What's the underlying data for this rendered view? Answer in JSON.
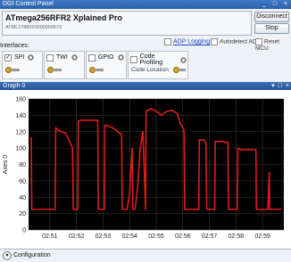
{
  "window": {
    "title": "DGI Control Panel",
    "buttons": [
      "_",
      "□",
      "×"
    ]
  },
  "device": {
    "name": "ATmega256RFR2 Xplained Pro",
    "serial": "ATML1788020000000573"
  },
  "buttons": {
    "disconnect": "Disconnect",
    "stop": "Stop"
  },
  "options": {
    "adp_logging": "ADP Logging",
    "autodetect_adp": "Autodetect ADP",
    "reset_mcu": "Reset MCU"
  },
  "interfaces": {
    "label": "Interfaces:",
    "items": [
      {
        "name": "SPI",
        "checked": true
      },
      {
        "name": "TWI",
        "checked": false
      },
      {
        "name": "GPIO",
        "checked": false
      }
    ],
    "code_profiling": {
      "name": "Code Profiling",
      "checked": false,
      "location_label": "Code Location"
    }
  },
  "graph": {
    "title": "Graph 0",
    "buttons": [
      "▾",
      "□",
      "×"
    ]
  },
  "configuration": {
    "label": "Configuration"
  },
  "chart_data": {
    "type": "line",
    "ylabel": "Axes 0",
    "xlabel": "",
    "ylim": [
      0,
      160
    ],
    "yticks": [
      0,
      20,
      40,
      60,
      80,
      100,
      120,
      140,
      160
    ],
    "xticks": [
      "02:51",
      "02:52",
      "02:53",
      "02:54",
      "02:55",
      "02:56",
      "02:57",
      "02:58",
      "02:59"
    ],
    "xlim": [
      50.2,
      59.8
    ],
    "grid": true,
    "colors": {
      "background": "#000000",
      "line": "#e01b1b",
      "grid": "#3a3a3a",
      "tick_text": "#222222"
    },
    "series": [
      {
        "name": "",
        "x": [
          50.25,
          50.3,
          50.32,
          50.5,
          50.7,
          51.1,
          51.2,
          51.22,
          51.3,
          51.6,
          51.85,
          51.88,
          52.0,
          52.05,
          52.07,
          52.2,
          52.6,
          52.8,
          52.82,
          53.0,
          53.05,
          53.07,
          53.2,
          53.4,
          53.7,
          53.72,
          53.9,
          54.0,
          54.05,
          54.1,
          54.12,
          54.2,
          54.3,
          54.4,
          54.5,
          54.6,
          54.62,
          54.8,
          55.0,
          55.2,
          55.4,
          55.6,
          55.8,
          55.9,
          56.0,
          56.05,
          56.07,
          56.1,
          56.3,
          56.5,
          56.6,
          56.62,
          56.8,
          56.85,
          56.87,
          56.9,
          57.0,
          57.1,
          57.2,
          57.22,
          57.3,
          57.5,
          57.6,
          57.7,
          57.72,
          57.8,
          57.9,
          58.0,
          58.05,
          58.07,
          58.2,
          58.4,
          58.6,
          58.75,
          58.77,
          58.85,
          59.0,
          59.1,
          59.2,
          59.25,
          59.27,
          59.4,
          59.7
        ],
        "y": [
          112,
          112,
          25,
          25,
          25,
          25,
          25,
          125,
          122,
          118,
          100,
          25,
          25,
          25,
          133,
          134,
          134,
          134,
          25,
          25,
          25,
          128,
          127,
          124,
          116,
          25,
          25,
          45,
          75,
          100,
          25,
          25,
          50,
          100,
          120,
          25,
          145,
          148,
          145,
          140,
          145,
          146,
          142,
          130,
          125,
          120,
          25,
          25,
          25,
          25,
          25,
          110,
          110,
          108,
          105,
          25,
          25,
          25,
          25,
          108,
          108,
          108,
          107,
          107,
          25,
          25,
          25,
          25,
          25,
          100,
          98,
          98,
          98,
          98,
          25,
          25,
          25,
          25,
          25,
          70,
          25,
          25,
          25
        ]
      }
    ]
  }
}
